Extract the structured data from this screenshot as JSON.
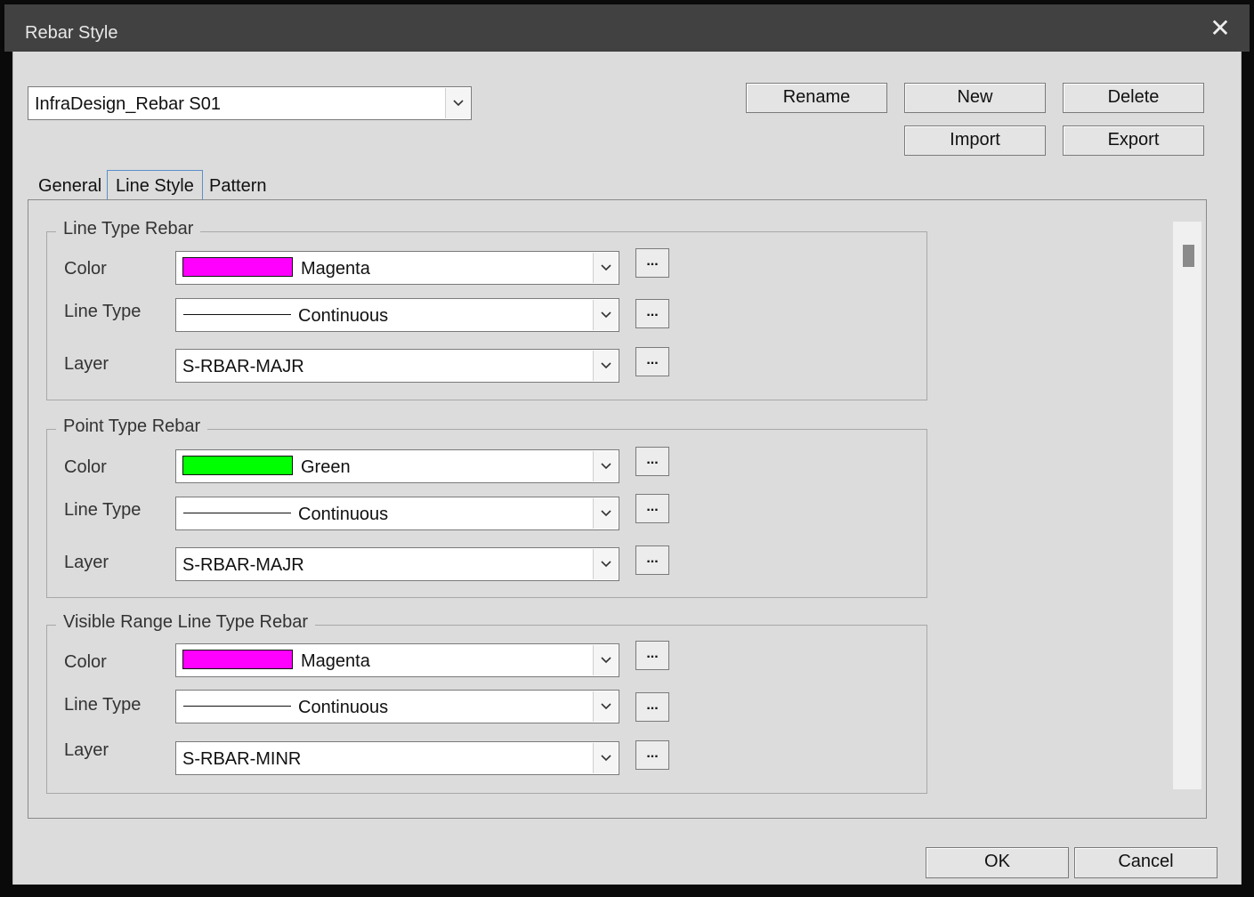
{
  "window": {
    "title": "Rebar Style",
    "close_symbol": "✕"
  },
  "style_select": {
    "value": "InfraDesign_Rebar S01"
  },
  "buttons": {
    "rename": "Rename",
    "new": "New",
    "delete": "Delete",
    "import": "Import",
    "export": "Export",
    "ok": "OK",
    "cancel": "Cancel"
  },
  "tabs": [
    {
      "label": "General",
      "active": false
    },
    {
      "label": "Line Style",
      "active": true
    },
    {
      "label": "Pattern",
      "active": false
    }
  ],
  "groups": [
    {
      "title": "Line Type Rebar",
      "color": {
        "label": "Color",
        "value": "Magenta",
        "swatch": "#ff00ff"
      },
      "line_type": {
        "label": "Line Type",
        "value": "Continuous"
      },
      "layer": {
        "label": "Layer",
        "value": "S-RBAR-MAJR"
      }
    },
    {
      "title": "Point Type Rebar",
      "color": {
        "label": "Color",
        "value": "Green",
        "swatch": "#00ff00"
      },
      "line_type": {
        "label": "Line Type",
        "value": "Continuous"
      },
      "layer": {
        "label": "Layer",
        "value": "S-RBAR-MAJR"
      }
    },
    {
      "title": "Visible Range Line Type Rebar",
      "color": {
        "label": "Color",
        "value": "Magenta",
        "swatch": "#ff00ff"
      },
      "line_type": {
        "label": "Line Type",
        "value": "Continuous"
      },
      "layer": {
        "label": "Layer",
        "value": "S-RBAR-MINR"
      }
    }
  ],
  "ellipsis": "...",
  "colors": {
    "titlebar": "#414141",
    "dialog": "#dcdcdc",
    "tab_focus": "#5b8fc9"
  }
}
